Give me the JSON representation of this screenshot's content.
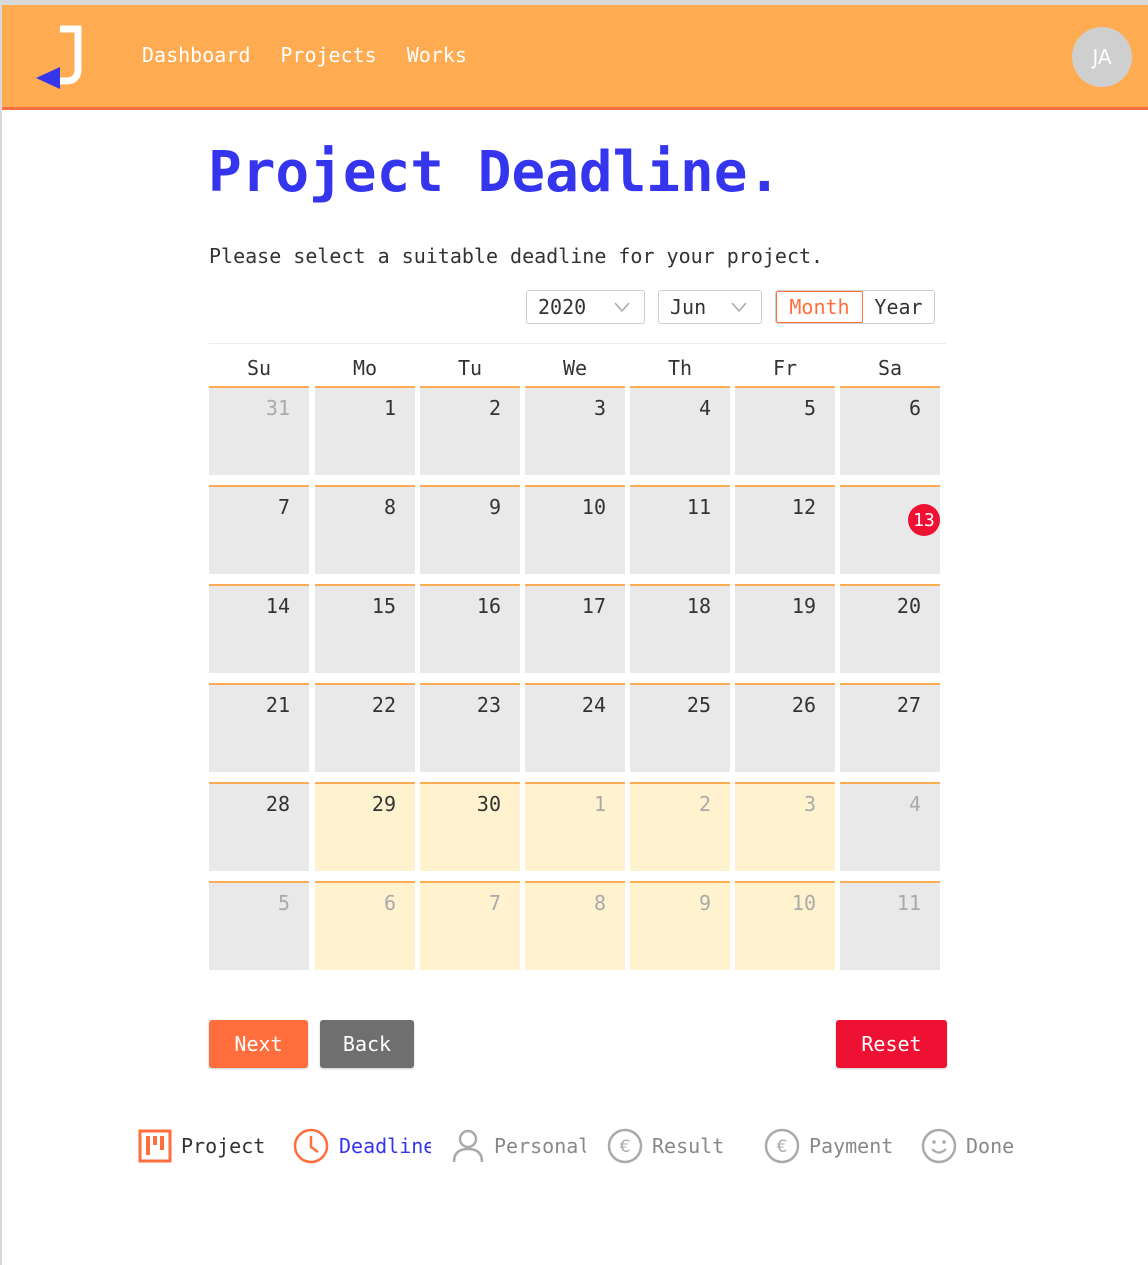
{
  "header": {
    "logo_letter": "J",
    "nav": [
      "Dashboard",
      "Projects",
      "Works"
    ],
    "avatar_initials": "JA"
  },
  "page": {
    "title": "Project Deadline.",
    "subtitle": "Please select a suitable deadline for your project."
  },
  "controls": {
    "year": "2020",
    "month": "Jun",
    "view_month": "Month",
    "view_year": "Year",
    "active_view": "Month"
  },
  "calendar": {
    "weekdays": [
      "Su",
      "Mo",
      "Tu",
      "We",
      "Th",
      "Fr",
      "Sa"
    ],
    "today": "13",
    "weeks": [
      [
        {
          "d": "31",
          "muted": true
        },
        {
          "d": "1"
        },
        {
          "d": "2"
        },
        {
          "d": "3"
        },
        {
          "d": "4"
        },
        {
          "d": "5"
        },
        {
          "d": "6"
        }
      ],
      [
        {
          "d": "7"
        },
        {
          "d": "8"
        },
        {
          "d": "9"
        },
        {
          "d": "10"
        },
        {
          "d": "11"
        },
        {
          "d": "12"
        },
        {
          "d": "13",
          "today": true
        }
      ],
      [
        {
          "d": "14"
        },
        {
          "d": "15"
        },
        {
          "d": "16"
        },
        {
          "d": "17"
        },
        {
          "d": "18"
        },
        {
          "d": "19"
        },
        {
          "d": "20"
        }
      ],
      [
        {
          "d": "21"
        },
        {
          "d": "22"
        },
        {
          "d": "23"
        },
        {
          "d": "24"
        },
        {
          "d": "25"
        },
        {
          "d": "26"
        },
        {
          "d": "27"
        }
      ],
      [
        {
          "d": "28"
        },
        {
          "d": "29",
          "sel": true
        },
        {
          "d": "30",
          "sel": true
        },
        {
          "d": "1",
          "muted": true,
          "sel": true
        },
        {
          "d": "2",
          "muted": true,
          "sel": true
        },
        {
          "d": "3",
          "muted": true,
          "sel": true
        },
        {
          "d": "4",
          "muted": true
        }
      ],
      [
        {
          "d": "5",
          "muted": true
        },
        {
          "d": "6",
          "muted": true,
          "sel": true
        },
        {
          "d": "7",
          "muted": true,
          "sel": true
        },
        {
          "d": "8",
          "muted": true,
          "sel": true
        },
        {
          "d": "9",
          "muted": true,
          "sel": true
        },
        {
          "d": "10",
          "muted": true,
          "sel": true
        },
        {
          "d": "11",
          "muted": true
        }
      ]
    ]
  },
  "actions": {
    "next": "Next",
    "back": "Back",
    "reset": "Reset"
  },
  "steps": [
    {
      "label": "Project",
      "icon": "kanban-icon",
      "state": "done"
    },
    {
      "label": "Deadline",
      "icon": "clock-icon",
      "state": "current"
    },
    {
      "label": "Personal",
      "icon": "user-icon",
      "state": "todo"
    },
    {
      "label": "Result",
      "icon": "euro-icon",
      "state": "todo"
    },
    {
      "label": "Payment",
      "icon": "euro-icon",
      "state": "todo"
    },
    {
      "label": "Done",
      "icon": "smile-icon",
      "state": "todo"
    }
  ],
  "colors": {
    "header": "#ffab52",
    "accent": "#ff6e3c",
    "title_blue": "#3535ee",
    "reset_red": "#ee1133",
    "back_gray": "#6f6f6f",
    "selected_cell": "#fff3cf",
    "cell": "#e9e9e9"
  }
}
